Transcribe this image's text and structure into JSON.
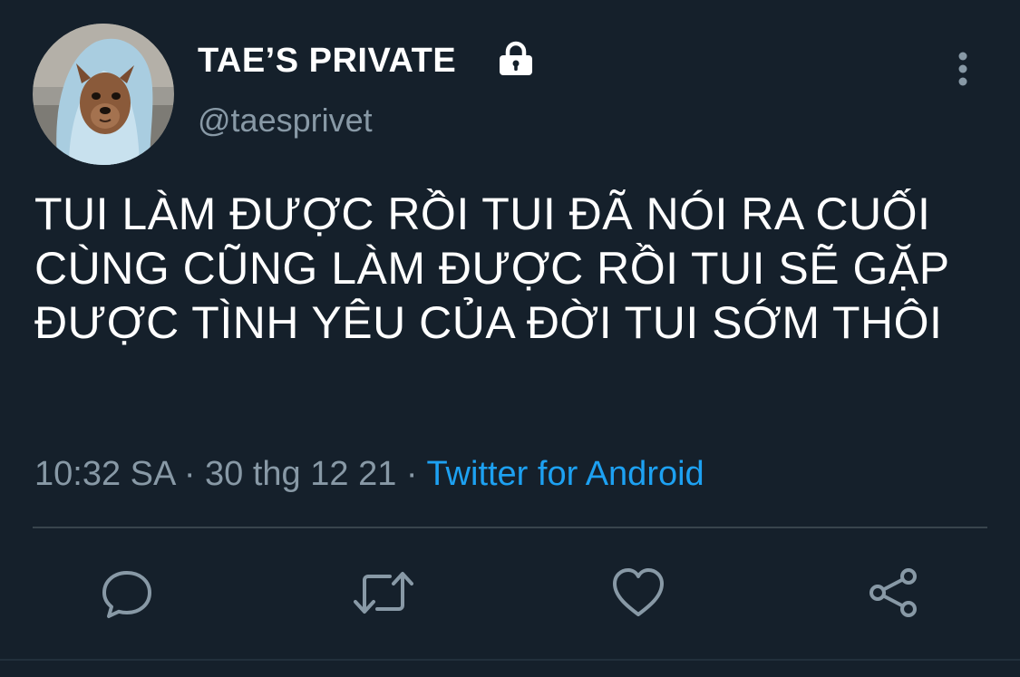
{
  "user": {
    "display_name": "TAE’S PRIVATE",
    "handle": "@taesprivet",
    "avatar_icon": "dog-in-hoodie-avatar",
    "protected_icon": "lock-icon"
  },
  "tweet": {
    "text": "TUI LÀM ĐƯỢC RỒI TUI ĐÃ NÓI RA CUỐI CÙNG CŨNG LÀM ĐƯỢC RỒI TUI SẼ GẶP ĐƯỢC TÌNH YÊU CỦA ĐỜI TUI SỚM THÔI",
    "time": "10:32 SA",
    "date": "30 thg 12 21",
    "separator": "·",
    "source": "Twitter for Android"
  },
  "actions": [
    {
      "name": "reply",
      "icon": "reply-icon"
    },
    {
      "name": "retweet",
      "icon": "retweet-icon"
    },
    {
      "name": "like",
      "icon": "heart-icon"
    },
    {
      "name": "share",
      "icon": "share-icon"
    }
  ],
  "colors": {
    "background": "#15202b",
    "primary_text": "#ffffff",
    "secondary_text": "#8899a6",
    "accent": "#1da1f2",
    "divider": "#38444d"
  }
}
